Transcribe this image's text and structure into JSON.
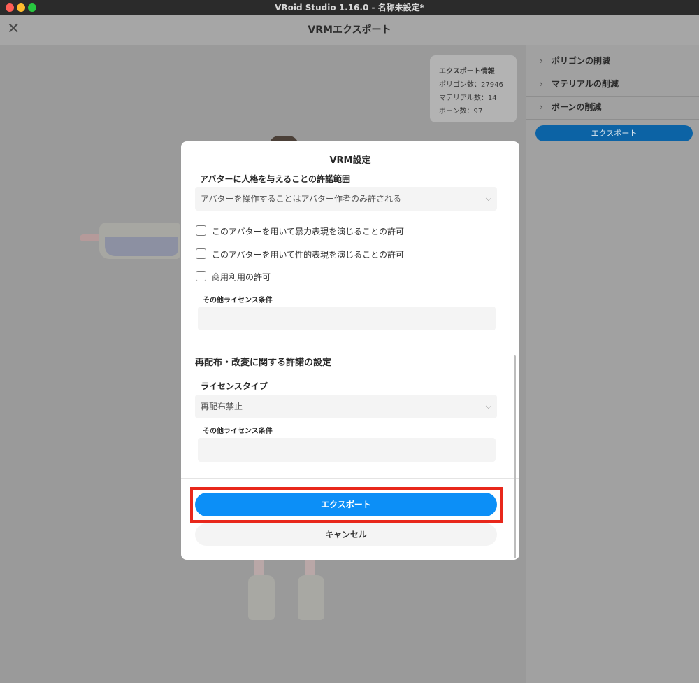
{
  "window": {
    "title": "VRoid Studio 1.16.0 - 名称未設定*"
  },
  "header": {
    "close_icon": "close-x-icon",
    "title": "VRMエクスポート"
  },
  "export_info": {
    "heading": "エクスポート情報",
    "polygons": "ポリゴン数：27946",
    "materials": "マテリアル数：14",
    "bones": "ボーン数：97"
  },
  "right_panel": {
    "items": [
      {
        "label": "ポリゴンの削減",
        "icon": "chevron-right-icon"
      },
      {
        "label": "マテリアルの削減",
        "icon": "chevron-right-icon"
      },
      {
        "label": "ボーンの削減",
        "icon": "chevron-right-icon"
      }
    ],
    "export_label": "エクスポート"
  },
  "modal": {
    "title": "VRM設定",
    "persona_label": "アバターに人格を与えることの許諾範囲",
    "persona_value": "アバターを操作することはアバター作者のみ許される",
    "checkboxes": [
      {
        "label": "このアバターを用いて暴力表現を演じることの許可",
        "checked": false
      },
      {
        "label": "このアバターを用いて性的表現を演じることの許可",
        "checked": false
      },
      {
        "label": "商用利用の許可",
        "checked": false
      }
    ],
    "other_license_label_1": "その他ライセンス条件",
    "other_license_value_1": "",
    "redistribution_section": "再配布・改変に関する許諾の設定",
    "license_type_label": "ライセンスタイプ",
    "license_type_value": "再配布禁止",
    "other_license_label_2": "その他ライセンス条件",
    "other_license_value_2": "",
    "export_button": "エクスポート",
    "cancel_button": "キャンセル"
  },
  "colors": {
    "accent": "#0c8ff7",
    "highlight": "#e8271b"
  }
}
